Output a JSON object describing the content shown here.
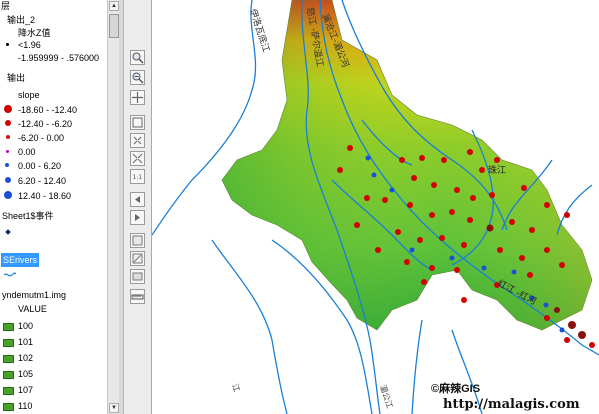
{
  "toc": {
    "header": "层",
    "layers": [
      {
        "name": "输出_2",
        "field": "降水Z值",
        "classes": [
          {
            "label": "<1.96",
            "color": "#000000"
          },
          {
            "label": "-1.959999 - .576000",
            "color": ""
          }
        ]
      },
      {
        "name": "输出",
        "field": "slope",
        "classes": [
          {
            "label": "-18.60 - -12.40",
            "color": "#d40000"
          },
          {
            "label": "-12.40 - -6.20",
            "color": "#d40000"
          },
          {
            "label": "-6.20 - 0.00",
            "color": "#e01010"
          },
          {
            "label": "0.00",
            "color": "#c000c0"
          },
          {
            "label": "0.00 - 6.20",
            "color": "#1a4fd8"
          },
          {
            "label": "6.20 - 12.40",
            "color": "#1a4fd8"
          },
          {
            "label": "12.40 - 18.60",
            "color": "#1a4fd8"
          }
        ]
      },
      {
        "name": "Sheet1$事件",
        "color": "#1a2a7a"
      },
      {
        "name": "SErivers",
        "selected": true
      },
      {
        "name": "yndemutm1.img",
        "field": "VALUE",
        "classes": [
          {
            "label": "100",
            "color": "#4aa02c"
          },
          {
            "label": "101",
            "color": "#4aa02c"
          },
          {
            "label": "102",
            "color": "#4aa02c"
          },
          {
            "label": "105",
            "color": "#4aa02c"
          },
          {
            "label": "107",
            "color": "#4aa02c"
          },
          {
            "label": "110",
            "color": "#4aa02c"
          }
        ]
      }
    ]
  },
  "map": {
    "labels": {
      "zhujiang": "珠江",
      "river_a": "伊洛瓦底江",
      "river_b": "怒江 -萨尔温江",
      "river_c": "红江 -红河",
      "river_d": "澜沧江-湄公河",
      "bottom_left": "江",
      "bottom_mid": "湄公江"
    },
    "credit": "©麻辣GIS",
    "url": "http://malagis.com"
  },
  "colors": {
    "selection": "#3399ff",
    "dem_low": "#5cc13a",
    "dem_high": "#e8231a",
    "river": "#1a7fd6",
    "point_neg": "#d40000",
    "point_pos": "#1a4fd8"
  }
}
